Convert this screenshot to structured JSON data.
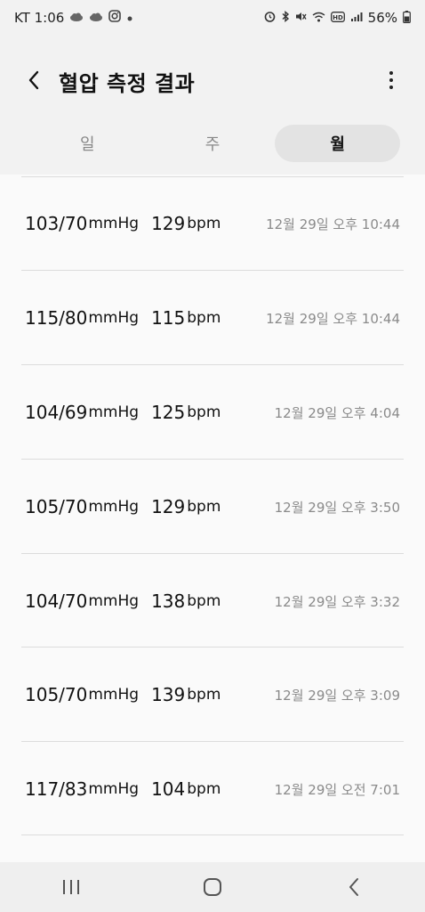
{
  "status_bar": {
    "carrier_time": "KT 1:06",
    "battery": "56%",
    "left_icons": [
      "cloud-icon",
      "cloud-icon",
      "instagram-icon",
      "dot-icon"
    ],
    "right_icons": [
      "alarm-icon",
      "bluetooth-icon",
      "mute-icon",
      "wifi-icon",
      "hd-icon",
      "signal-icon",
      "battery-icon"
    ]
  },
  "header": {
    "title": "혈압 측정 결과",
    "back_icon": "chevron-left-icon",
    "more_icon": "more-vertical-icon"
  },
  "tabs": [
    {
      "label": "일",
      "active": false
    },
    {
      "label": "주",
      "active": false
    },
    {
      "label": "월",
      "active": true
    }
  ],
  "records": [
    {
      "bp": "103/70",
      "bp_unit": "mmHg",
      "pulse": "129",
      "pulse_unit": "bpm",
      "time": "12월 29일 오후 10:44"
    },
    {
      "bp": "115/80",
      "bp_unit": "mmHg",
      "pulse": "115",
      "pulse_unit": "bpm",
      "time": "12월 29일 오후 10:44"
    },
    {
      "bp": "104/69",
      "bp_unit": "mmHg",
      "pulse": "125",
      "pulse_unit": "bpm",
      "time": "12월 29일 오후 4:04"
    },
    {
      "bp": "105/70",
      "bp_unit": "mmHg",
      "pulse": "129",
      "pulse_unit": "bpm",
      "time": "12월 29일 오후 3:50"
    },
    {
      "bp": "104/70",
      "bp_unit": "mmHg",
      "pulse": "138",
      "pulse_unit": "bpm",
      "time": "12월 29일 오후 3:32"
    },
    {
      "bp": "105/70",
      "bp_unit": "mmHg",
      "pulse": "139",
      "pulse_unit": "bpm",
      "time": "12월 29일 오후 3:09"
    },
    {
      "bp": "117/83",
      "bp_unit": "mmHg",
      "pulse": "104",
      "pulse_unit": "bpm",
      "time": "12월 29일 오전 7:01"
    }
  ],
  "nav_bar": {
    "icons": [
      "recents-icon",
      "home-icon",
      "back-icon"
    ]
  }
}
